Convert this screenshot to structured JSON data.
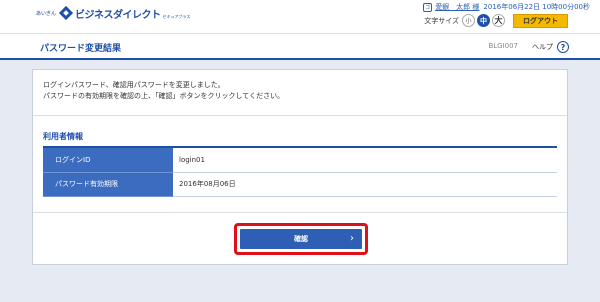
{
  "header": {
    "logo_small": "あいぎん",
    "logo_brand": "ビジネスダイレクト",
    "logo_sub": "セキュアプラス",
    "user_icon": "ゴ",
    "user_name": "愛銀　太郎 様",
    "datetime": "2016年06月22日 10時00分00秒",
    "font_size_label": "文字サイズ",
    "font_small": "小",
    "font_medium": "中",
    "font_large": "大",
    "logout_label": "ログアウト"
  },
  "titlebar": {
    "title": "パスワード変更結果",
    "screen_id": "BLGI007",
    "help_label": "ヘルプ",
    "help_icon": "?"
  },
  "message": {
    "line1": "ログインパスワード、確認用パスワードを変更しました。",
    "line2": "パスワードの有効期限を確認の上、「確認」ボタンをクリックしてください。"
  },
  "user_info": {
    "section_title": "利用者情報",
    "rows": [
      {
        "label": "ログインID",
        "value": "login01"
      },
      {
        "label": "パスワード有効期限",
        "value": "2016年08月06日"
      }
    ]
  },
  "actions": {
    "confirm_label": "確認",
    "confirm_chevron": "›"
  }
}
